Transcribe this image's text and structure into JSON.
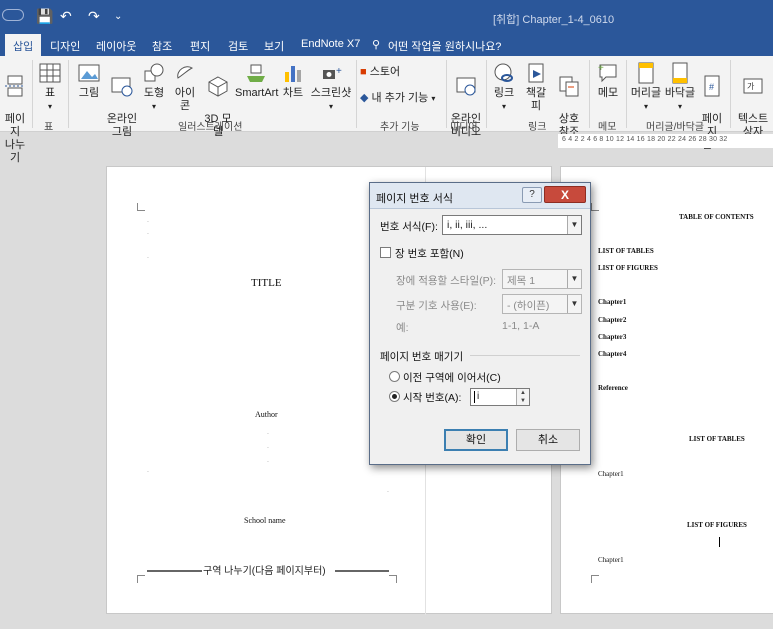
{
  "window": {
    "doc_title": "[취합] Chapter_1-4_0610"
  },
  "tabs": [
    "삽입",
    "디자인",
    "레이아웃",
    "참조",
    "편지",
    "검토",
    "보기",
    "EndNote X7"
  ],
  "tell_me": "어떤 작업을 원하시나요?",
  "ribbon": {
    "buttons": {
      "page_break": "페이지\n나누기",
      "table": "표",
      "picture": "그림",
      "online_picture": "온라인\n그림",
      "shapes": "도형",
      "icons": "아이콘",
      "model3d": "3D 모\n델",
      "smartart": "SmartArt",
      "chart": "차트",
      "screenshot": "스크린샷",
      "store": "스토어",
      "my_addins": "내 추가 기능",
      "online_video": "온라인\n비디오",
      "link": "링크",
      "bookmark": "책갈피",
      "cross_ref": "상호\n참조",
      "comment": "메모",
      "header": "머리글",
      "footer": "바닥글",
      "page_number": "페이지\n번호",
      "textbox": "텍스트\n상자"
    },
    "groups": {
      "tables": "표",
      "illustrations": "일러스트레이션",
      "addins": "추가 기능",
      "media": "미디어",
      "links": "링크",
      "comments": "메모",
      "header_footer": "머리글/바닥글"
    }
  },
  "ruler": "6 4 2   2 4 6 8 10 12 14 16 18 20 22 24 26 28 30 32",
  "left_page": {
    "title": "TITLE",
    "author": "Author",
    "school": "School name",
    "section_break": "구역 나누기(다음 페이지부터)"
  },
  "right_page": {
    "toc": "TABLE OF CONTENTS",
    "list_tables": "LIST OF TABLES",
    "list_figures": "LIST OF FIGURES",
    "chapters": [
      "Chapter1",
      "Chapter2",
      "Chapter3",
      "Chapter4"
    ],
    "reference": "Reference",
    "lot_heading": "LIST OF TABLES",
    "lot_item": "Chapter1",
    "lof_heading": "LIST OF FIGURES",
    "lof_item": "Chapter1"
  },
  "dialog": {
    "title": "페이지 번호 서식",
    "help": "?",
    "close": "X",
    "number_format_label": "번호 서식(F):",
    "number_format_value": "i, ii, iii, ...",
    "include_chapter_label": "장 번호 포함(N)",
    "chapter_style_label": "장에 적용할 스타일(P):",
    "chapter_style_value": "제목 1",
    "separator_label": "구분 기호 사용(E):",
    "separator_value": "-  (하이픈)",
    "example_label": "예:",
    "example_value": "1-1, 1-A",
    "page_numbering_label": "페이지 번호 매기기",
    "continue_label": "이전 구역에 이어서(C)",
    "start_at_label": "시작 번호(A):",
    "start_at_value": "i",
    "ok": "확인",
    "cancel": "취소"
  }
}
